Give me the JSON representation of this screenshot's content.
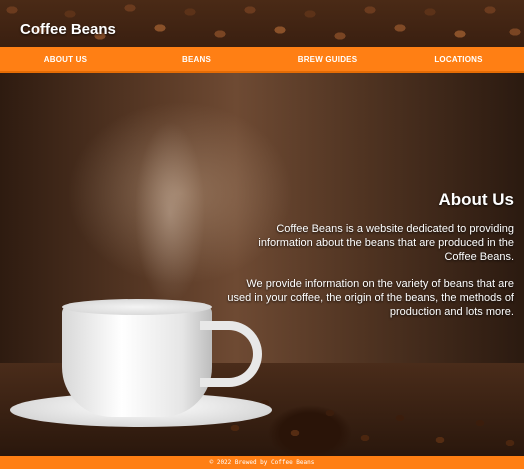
{
  "header": {
    "site_title": "Coffee Beans"
  },
  "nav": {
    "items": [
      {
        "label": "ABOUT US"
      },
      {
        "label": "BEANS"
      },
      {
        "label": "BREW GUIDES"
      },
      {
        "label": "LOCATIONS"
      }
    ]
  },
  "about": {
    "heading": "About Us",
    "paragraphs": [
      "Coffee Beans is a website dedicated to providing information about the beans that are produced in the Coffee Beans.",
      "We provide information on the variety of beans that are used in your coffee, the origin of the beans, the methods of production and lots more."
    ]
  },
  "footer": {
    "text": "© 2022 Brewed by Coffee Beans"
  },
  "colors": {
    "accent": "#ff7f14",
    "text_on_accent": "#ffffff"
  }
}
